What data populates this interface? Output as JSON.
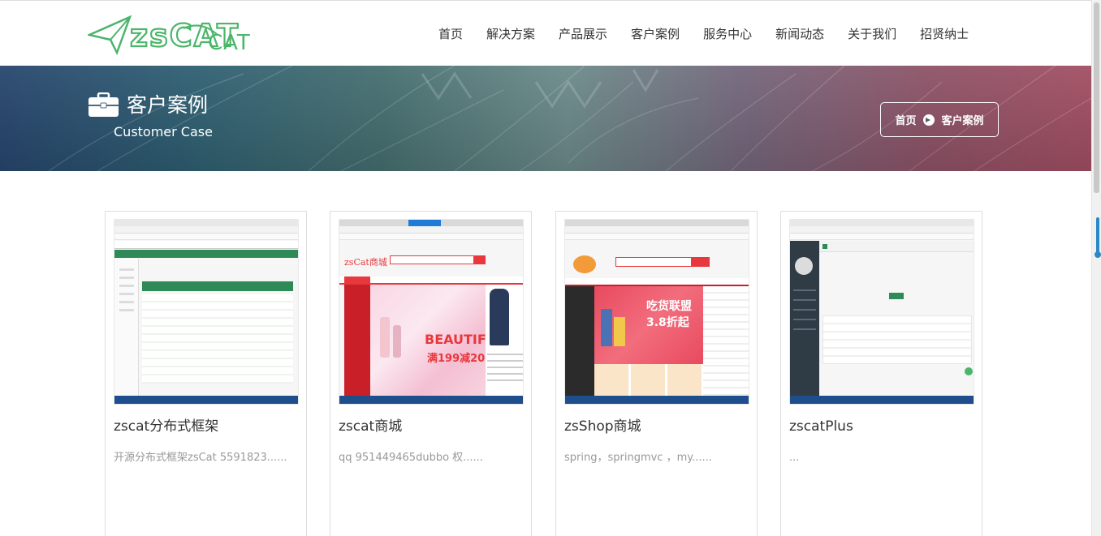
{
  "header": {
    "logo_text": "zsCAT",
    "nav": [
      "首页",
      "解决方案",
      "产品展示",
      "客户案例",
      "服务中心",
      "新闻动态",
      "关于我们",
      "招贤纳士"
    ]
  },
  "banner": {
    "title": "客户案例",
    "subtitle": "Customer Case",
    "breadcrumb": {
      "home": "首页",
      "current": "客户案例"
    }
  },
  "cards": [
    {
      "title": "zscat分布式框架",
      "desc": "开源分布式框架zsCat 5591823......"
    },
    {
      "title": "zscat商城",
      "desc": "qq 951449465dubbo 权......"
    },
    {
      "title": "zsShop商城",
      "desc": "spring，springmvc ，my......"
    },
    {
      "title": "zscatPlus",
      "desc": "..."
    }
  ],
  "colors": {
    "green_logo": "#4bb56a",
    "mall_red": "#e8383d",
    "admin_green": "#2e8b57",
    "admin_dark": "#2f3b45"
  }
}
